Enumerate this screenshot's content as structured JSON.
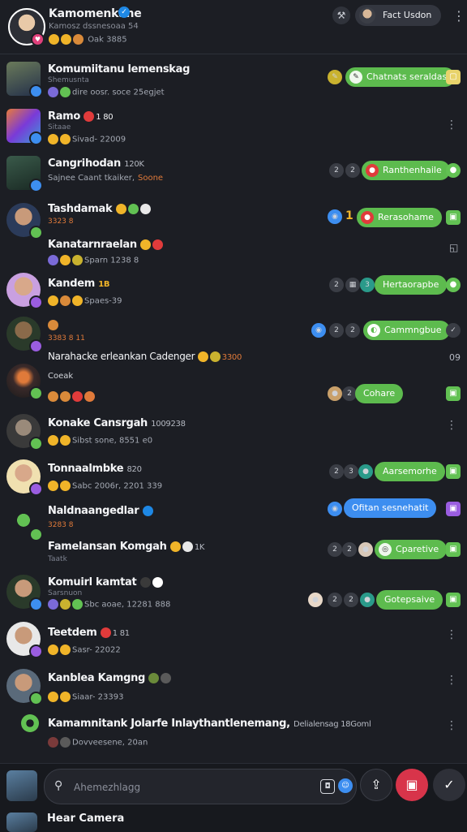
{
  "header": {
    "title": "Kamomenkane",
    "subtitle": "Kamosz dssnesoaa 54",
    "stats": "Oak 3885",
    "pill_label": "Fact Usdon"
  },
  "rows": [
    {
      "name": "Komumiitanu lemenskag",
      "sub": "Shemusnta",
      "meta": "dire oosr. soce 25egjet",
      "action": "Chatnats seraldas",
      "action_color": "green",
      "badge_color": "#3d8ef0"
    },
    {
      "name": "Ramo",
      "count": "1 80",
      "sub": "Sitaae",
      "meta": "Sivad- 22009",
      "badge_color": "#3d8ef0"
    },
    {
      "name": "Cangrihodan",
      "count": "120K",
      "sub": "Sajnee Caant tkaiker,",
      "meta": "Soone",
      "action": "Ranthenhaile",
      "action_color": "green",
      "badge_color": "#3d8ef0"
    },
    {
      "name": "Tashdamak",
      "sub": "3323 8",
      "meta": "",
      "action": "Rerasohame",
      "action_color": "green",
      "badge_color": "#62c153",
      "count": "1"
    },
    {
      "name": "Kanatarnraelan",
      "sub": "",
      "meta": "Sparn 1238 8",
      "badge_color": "#62c153"
    },
    {
      "name": "Kandem",
      "count": "1B",
      "sub": "",
      "meta": "Spaes-39",
      "action": "Hertaorapbe",
      "action_color": "green",
      "badge_color": "#9a5de0"
    },
    {
      "name": "",
      "sub": "3383 8 11",
      "meta": "",
      "action": "Cammngbue",
      "action_color": "green",
      "badge_color": "#9a5de0"
    },
    {
      "name": "Narahacke erleankan Cadenger",
      "sub": "",
      "meta": "3300",
      "count": "09",
      "badge_color": "#9a5de0"
    },
    {
      "name": "Coeak",
      "sub": "",
      "meta": "",
      "action": "Cohare",
      "action_color": "green",
      "badge_color": "#62c153"
    },
    {
      "name": "Konake Cansrgah",
      "count": "1009238",
      "sub": "",
      "meta": "Sibst sone, 8551 e0",
      "badge_color": "#62c153"
    },
    {
      "name": "Tonnaalmbke",
      "count": "820",
      "sub": "",
      "meta": "Sabc 2006r, 2201 339",
      "action": "Aarsemorhe",
      "action_color": "green",
      "badge_color": "#9a5de0"
    },
    {
      "name": "Naldnaangedlar",
      "sub": "3283 8",
      "meta": "",
      "action": "Ofitan sesnehatit",
      "action_color": "blue",
      "badge_color": "#62c153"
    },
    {
      "name": "Famelansan Komgah",
      "count": "1K",
      "sub": "Taatk",
      "meta": "",
      "action": "Cparetive",
      "action_color": "green",
      "badge_color": "#62c153"
    },
    {
      "name": "Komuirl kamtat",
      "sub": "Sarsnuon",
      "meta": "Sbc aoae, 12281 888",
      "action": "Gotepsaive",
      "action_color": "green",
      "badge_color": "#3d8ef0"
    },
    {
      "name": "Teetdem",
      "count": "1 81",
      "sub": "",
      "meta": "Sasr- 22022",
      "badge_color": "#9a5de0"
    },
    {
      "name": "Kanblea Kamgng",
      "sub": "",
      "meta": "Siaar- 23393",
      "badge_color": "#62c153"
    },
    {
      "name": "Kamamnitank Jolarfe Inlaythantlenemang,",
      "count": "Delialensag 18Goml",
      "sub": "",
      "meta": "Dovveesene, 20an",
      "badge_color": "#62c153"
    }
  ],
  "composer": {
    "placeholder": "Ahemezhlagg",
    "bottom_name": "Hear Camera"
  }
}
